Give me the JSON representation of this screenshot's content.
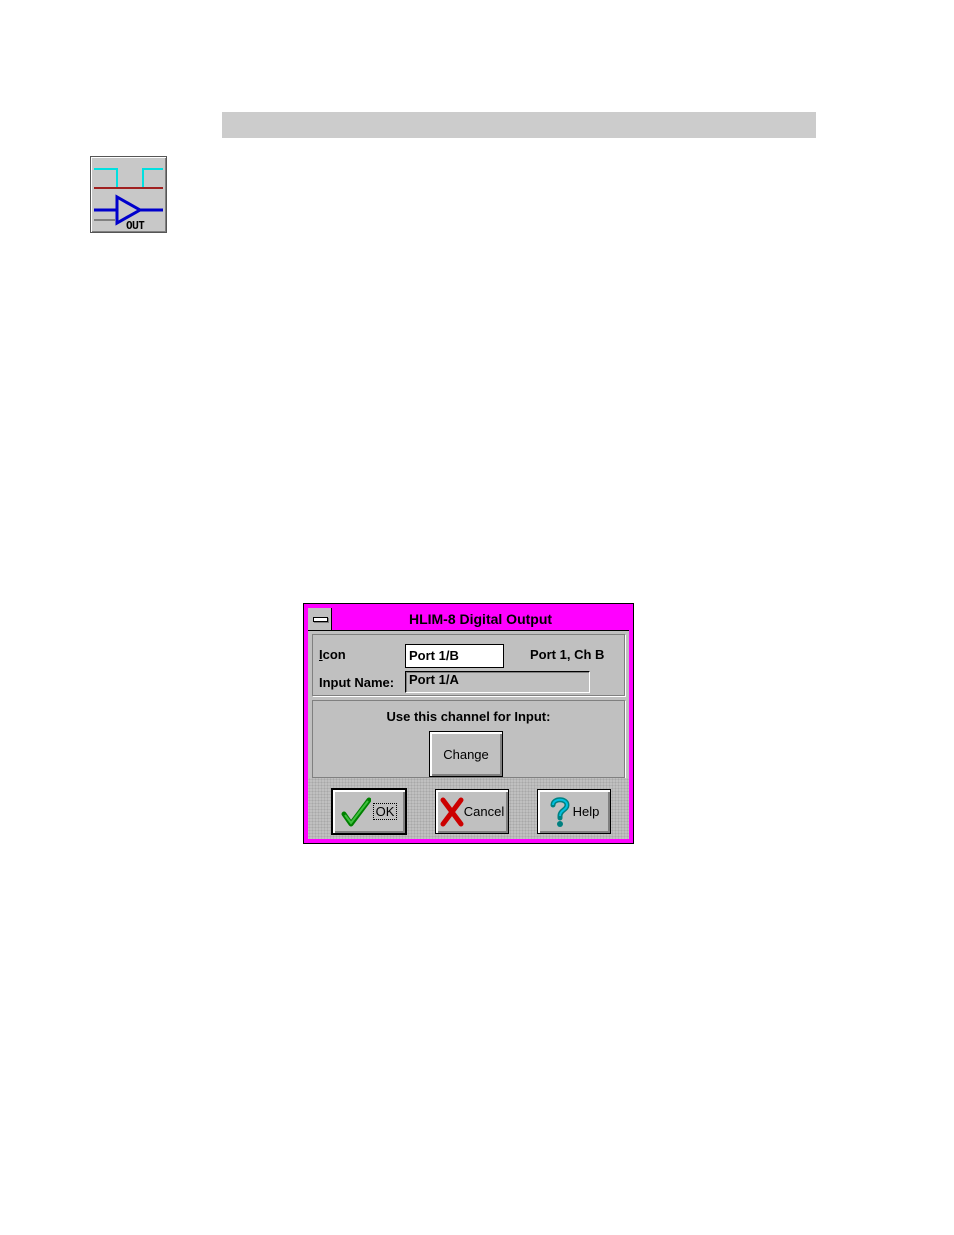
{
  "icon": {
    "name": "digital-output-icon",
    "badge": "OUT"
  },
  "dialog": {
    "title": "HLIM-8 Digital Output",
    "icon_label_underline": "I",
    "icon_label_rest": "con",
    "icon_value": "Port 1/B",
    "port_info": "Port 1, Ch B",
    "input_name_label": "Input Name:",
    "input_name_value": "Port 1/A",
    "use_channel_label": "Use this channel for Input:",
    "change_label": "Change",
    "ok_label": "OK",
    "cancel_label": "Cancel",
    "help_label": "Help"
  },
  "colors": {
    "dialog_frame": "#ff00ff",
    "dialog_face": "#c0c0c0",
    "section_bar": "#cccccc"
  }
}
